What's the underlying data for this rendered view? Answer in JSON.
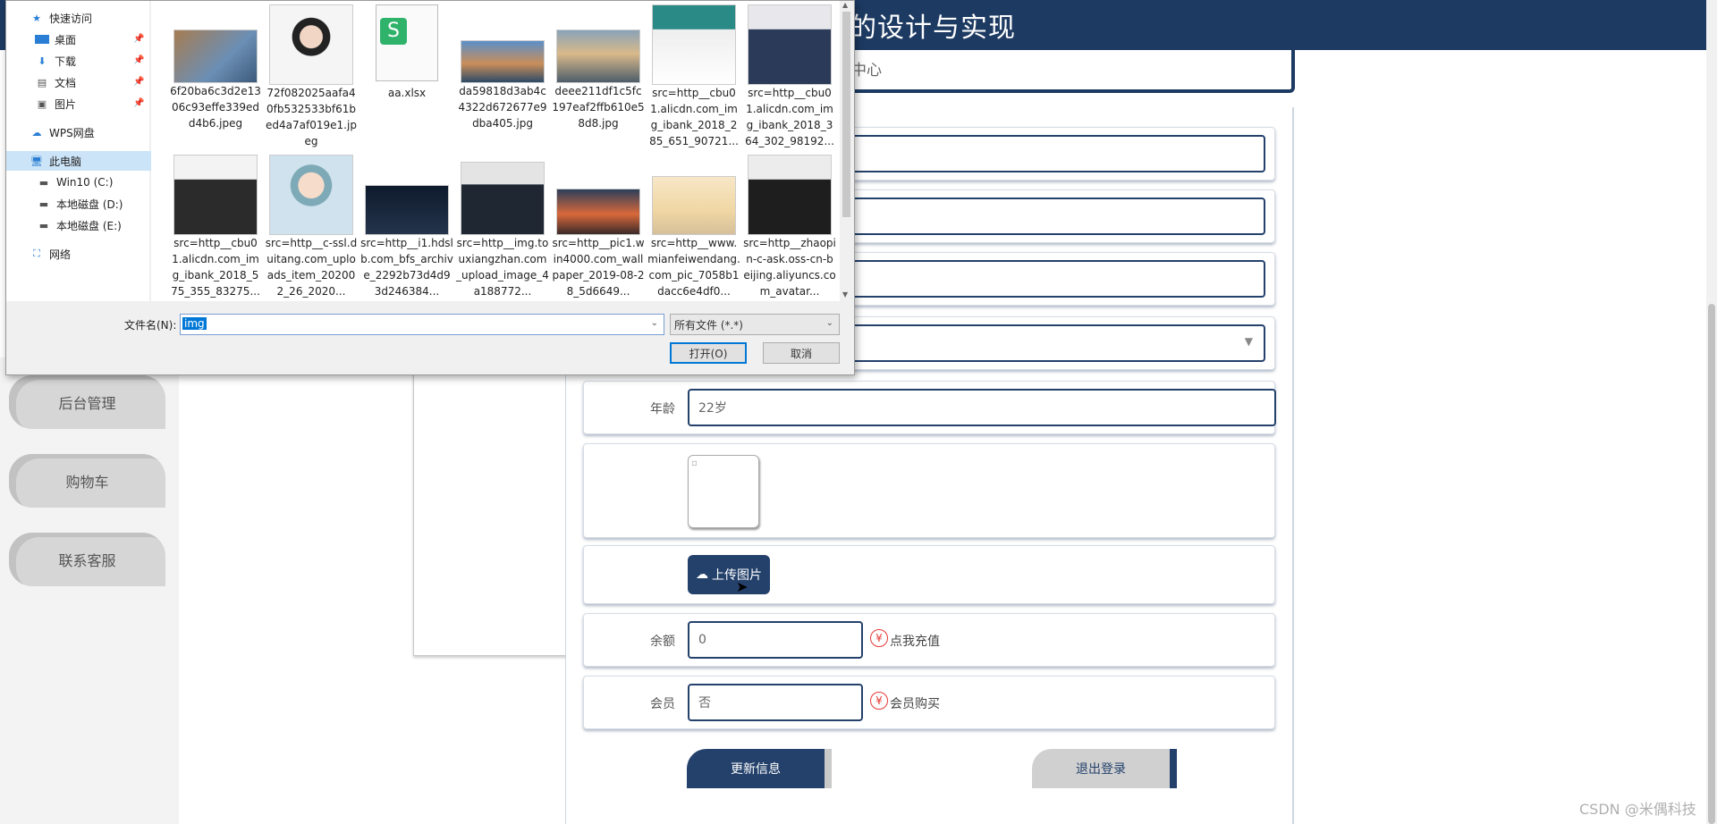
{
  "page": {
    "title_fragment": "的设计与实现",
    "nav_fragment": "中心",
    "sidebar": [
      "后台管理",
      "购物车",
      "联系客服"
    ],
    "form": {
      "age_label": "年龄",
      "age_value": "22岁",
      "upload_label": "上传图片",
      "balance_label": "余额",
      "balance_value": "0",
      "recharge_link": "点我充值",
      "member_label": "会员",
      "member_value": "否",
      "buy_member_link": "会员购买",
      "yen_symbol": "¥"
    },
    "buttons": {
      "update": "更新信息",
      "logout": "退出登录"
    },
    "watermark": "CSDN @米偶科技",
    "colors": {
      "primary": "#1d3a62",
      "accent": "#24416b",
      "danger": "#e53935"
    }
  },
  "dialog": {
    "tree": [
      {
        "label": "快速访问",
        "icon": "star-icon"
      },
      {
        "label": "桌面",
        "icon": "desktop-icon",
        "pinned": true
      },
      {
        "label": "下载",
        "icon": "download-icon",
        "pinned": true
      },
      {
        "label": "文档",
        "icon": "document-icon",
        "pinned": true
      },
      {
        "label": "图片",
        "icon": "picture-icon",
        "pinned": true
      },
      {
        "label": "WPS网盘",
        "icon": "cloud-icon"
      },
      {
        "label": "此电脑",
        "icon": "computer-icon",
        "selected": true
      },
      {
        "label": "Win10 (C:)",
        "icon": "drive-icon"
      },
      {
        "label": "本地磁盘 (D:)",
        "icon": "drive-icon"
      },
      {
        "label": "本地磁盘 (E:)",
        "icon": "drive-icon"
      },
      {
        "label": "网络",
        "icon": "network-icon"
      }
    ],
    "files_row1": [
      {
        "name": "6f20ba6c3d2e1306c93effe339edd4b6.jpeg",
        "icon": "landscape-thumb"
      },
      {
        "name": "72f082025aafa40fb532533bf61bed4a7af019e1.jpeg",
        "icon": "avatar-thumb"
      },
      {
        "name": "aa.xlsx",
        "icon": "spreadsheet-icon"
      },
      {
        "name": "da59818d3ab4c4322d672677e9dba405.jpg",
        "icon": "landscape-thumb"
      },
      {
        "name": "deee211df1c5fc197eaf2ffb610e58d8.jpg",
        "icon": "landscape-thumb"
      },
      {
        "name": "src=http__cbu01.alicdn.com_img_ibank_2018_285_651_90721...",
        "icon": "portrait-thumb"
      },
      {
        "name": "src=http__cbu01.alicdn.com_img_ibank_2018_364_302_98192...",
        "icon": "portrait-thumb"
      }
    ],
    "files_row2": [
      {
        "name": "src=http__cbu01.alicdn.com_img_ibank_2018_575_355_83275...",
        "icon": "portrait-thumb"
      },
      {
        "name": "src=http__c-ssl.duitang.com_uploads_item_202002_26_2020...",
        "icon": "cartoon-thumb"
      },
      {
        "name": "src=http__i1.hdslb.com_bfs_archive_2292b73d4d93d246384...",
        "icon": "night-thumb"
      },
      {
        "name": "src=http__img.touxiangzhan.com_upload_image_4a188772...",
        "icon": "portrait-thumb"
      },
      {
        "name": "src=http__pic1.win4000.com_wallpaper_2019-08-28_5d6649...",
        "icon": "sunset-thumb"
      },
      {
        "name": "src=http__www.mianfeiwendang.com_pic_7058b1dacc6e4df0...",
        "icon": "sky-thumb"
      },
      {
        "name": "src=http__zhaopin-c-ask.oss-cn-beijing.aliyuncs.com_avatar...",
        "icon": "portrait-thumb"
      }
    ],
    "filename_label": "文件名(N):",
    "filename_value": "img",
    "filetype_value": "所有文件 (*.*)",
    "open_button": "打开(O)",
    "cancel_button": "取消"
  }
}
